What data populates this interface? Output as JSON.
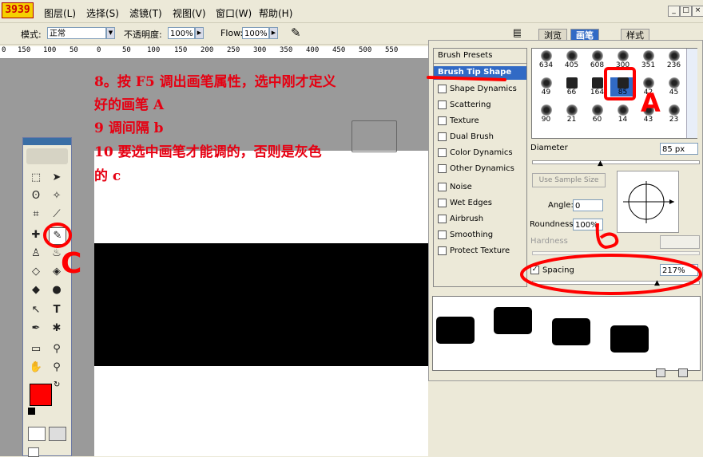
{
  "logo_text": "3939",
  "menu": [
    "图层(L)",
    "选择(S)",
    "滤镜(T)",
    "视图(V)",
    "窗口(W)",
    "帮助(H)"
  ],
  "window_buttons": [
    "_",
    "□",
    "×"
  ],
  "options": {
    "mode_label": "模式:",
    "mode_value": "正常",
    "opacity_label": "不透明度:",
    "opacity_value": "100%",
    "flow_label": "Flow:",
    "flow_value": "100%"
  },
  "ruler_ticks": [
    "0",
    "150",
    "100",
    "50",
    "0",
    "50",
    "100",
    "150",
    "200",
    "250",
    "300",
    "350",
    "400",
    "450",
    "500",
    "550"
  ],
  "annotations": {
    "line1": "8。按 F5 调出画笔属性，选中刚才定义",
    "line2": "好的画笔 A",
    "line3": "9 调间隔 b",
    "line4": "10 要选中画笔才能调的，否则是灰色",
    "line5": "的 c",
    "mark_a": "A",
    "mark_b": "b",
    "mark_c": "C"
  },
  "panel": {
    "tabs": [
      "浏览",
      "画笔",
      "样式"
    ],
    "brush_presets": "Brush Presets",
    "brush_tip_shape": "Brush Tip Shape",
    "options": [
      {
        "label": "Shape Dynamics",
        "checked": false
      },
      {
        "label": "Scattering",
        "checked": false
      },
      {
        "label": "Texture",
        "checked": false
      },
      {
        "label": "Dual Brush",
        "checked": false
      },
      {
        "label": "Color Dynamics",
        "checked": false
      },
      {
        "label": "Other Dynamics",
        "checked": false
      },
      {
        "label": "Noise",
        "checked": false
      },
      {
        "label": "Wet Edges",
        "checked": false
      },
      {
        "label": "Airbrush",
        "checked": false
      },
      {
        "label": "Smoothing",
        "checked": false
      },
      {
        "label": "Protect Texture",
        "checked": false
      }
    ],
    "brush_sizes": [
      "634",
      "405",
      "608",
      "300",
      "351",
      "236",
      "49",
      "66",
      "164",
      "85",
      "42",
      "45",
      "90",
      "21",
      "60",
      "14",
      "43",
      "23"
    ],
    "diameter_label": "Diameter",
    "diameter_value": "85 px",
    "use_sample_size": "Use Sample Size",
    "angle_label": "Angle:",
    "angle_value": "0",
    "roundness_label": "Roundness:",
    "roundness_value": "100%",
    "hardness_label": "Hardness",
    "spacing_label": "Spacing",
    "spacing_value": "217%",
    "spacing_checked": true
  },
  "colors": {
    "foreground": "#ff0000",
    "background": "#ffffff",
    "annotation": "#e60012",
    "selection": "#316ac5"
  }
}
